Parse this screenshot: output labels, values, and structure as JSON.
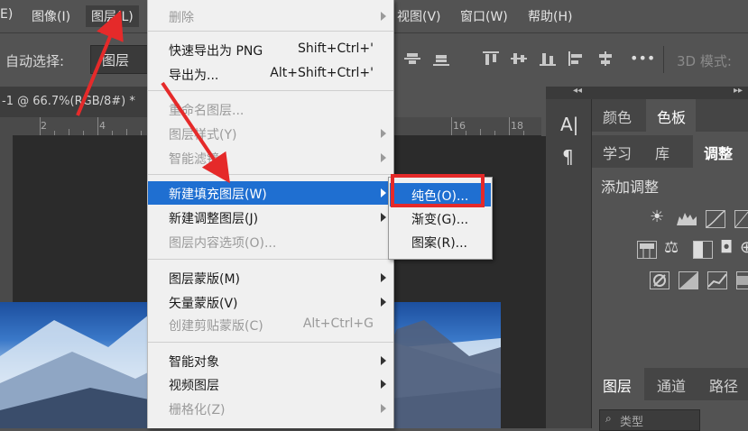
{
  "menubar": {
    "items": [
      "E)",
      "图像(I)",
      "图层(L)",
      "视图(V)",
      "窗口(W)",
      "帮助(H)"
    ]
  },
  "options": {
    "auto_select_label": "自动选择:",
    "auto_select_value": "图层",
    "more": "•••",
    "mode_label": "3D 模式:"
  },
  "document": {
    "tab_title": "-1 @ 66.7%(RGB/8#) *",
    "ruler_numbers": [
      "2",
      "4",
      "16",
      "18"
    ]
  },
  "main_menu": {
    "items": [
      {
        "label": "删除",
        "shortcut": "",
        "submenu": true,
        "disabled": true
      },
      {
        "label": "快速导出为 PNG",
        "shortcut": "Shift+Ctrl+'",
        "submenu": false,
        "disabled": false
      },
      {
        "label": "导出为...",
        "shortcut": "Alt+Shift+Ctrl+'",
        "submenu": false,
        "disabled": false
      },
      {
        "label": "重命名图层...",
        "shortcut": "",
        "submenu": false,
        "disabled": true
      },
      {
        "label": "图层样式(Y)",
        "shortcut": "",
        "submenu": true,
        "disabled": true
      },
      {
        "label": "智能滤镜",
        "shortcut": "",
        "submenu": true,
        "disabled": true
      },
      {
        "label": "新建填充图层(W)",
        "shortcut": "",
        "submenu": true,
        "disabled": false,
        "highlighted": true
      },
      {
        "label": "新建调整图层(J)",
        "shortcut": "",
        "submenu": true,
        "disabled": false
      },
      {
        "label": "图层内容选项(O)...",
        "shortcut": "",
        "submenu": false,
        "disabled": true
      },
      {
        "label": "图层蒙版(M)",
        "shortcut": "",
        "submenu": true,
        "disabled": false
      },
      {
        "label": "矢量蒙版(V)",
        "shortcut": "",
        "submenu": true,
        "disabled": false
      },
      {
        "label": "创建剪贴蒙版(C)",
        "shortcut": "Alt+Ctrl+G",
        "submenu": false,
        "disabled": true
      },
      {
        "label": "智能对象",
        "shortcut": "",
        "submenu": true,
        "disabled": false
      },
      {
        "label": "视频图层",
        "shortcut": "",
        "submenu": true,
        "disabled": false
      },
      {
        "label": "栅格化(Z)",
        "shortcut": "",
        "submenu": true,
        "disabled": true
      }
    ]
  },
  "submenu": {
    "items": [
      "纯色(O)...",
      "渐变(G)...",
      "图案(R)..."
    ]
  },
  "right_panel": {
    "tabs_row1": [
      "颜色",
      "色板"
    ],
    "tabs_row2": [
      "学习",
      "库",
      "调整"
    ],
    "adjust_title": "添加调整",
    "tabs_row3": [
      "图层",
      "通道",
      "路径"
    ],
    "search_placeholder": "类型"
  },
  "toolcol": {
    "char_glyph": "A|",
    "para_glyph": "¶"
  },
  "colors": {
    "highlight": "#1f6fd1",
    "annotation": "#e52a2a"
  }
}
